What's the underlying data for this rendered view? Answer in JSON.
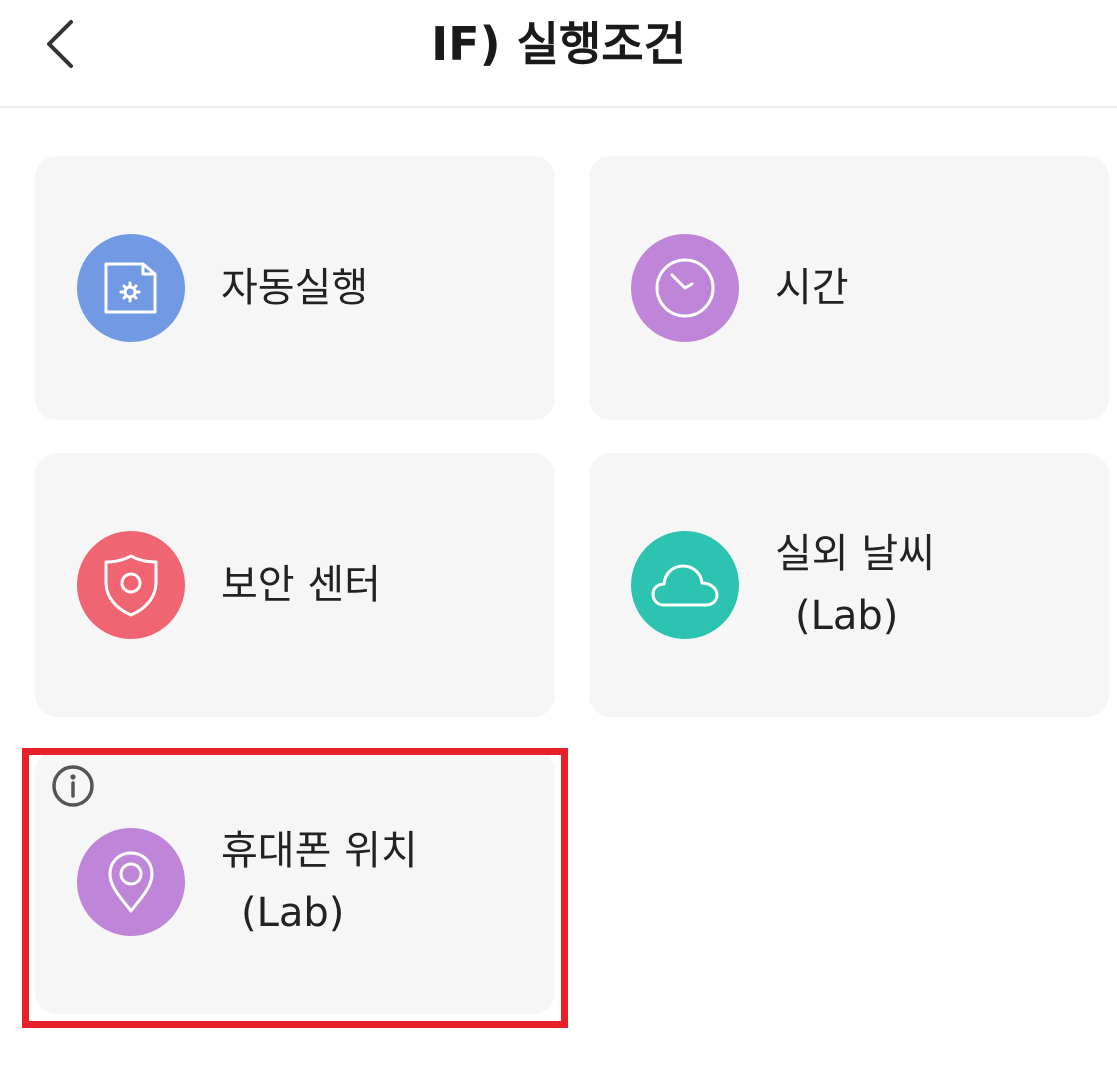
{
  "header": {
    "back_icon": "chevron-left-icon",
    "title": "IF) 실행조건"
  },
  "cards": [
    {
      "label": "자동실행",
      "sub": "",
      "icon": "auto-run-icon",
      "color": "#7199e4"
    },
    {
      "label": "시간",
      "sub": "",
      "icon": "clock-icon",
      "color": "#bf85d9"
    },
    {
      "label": "보안 센터",
      "sub": "",
      "icon": "shield-icon",
      "color": "#ef6571"
    },
    {
      "label": "실외 날씨",
      "sub": "(Lab)",
      "icon": "cloud-icon",
      "color": "#2cc4b1"
    },
    {
      "label": "휴대폰 위치",
      "sub": "(Lab)",
      "icon": "location-pin-icon",
      "color": "#bf85d9",
      "info_icon": "info-icon",
      "highlighted": true
    }
  ],
  "highlight_color": "#e8202a"
}
